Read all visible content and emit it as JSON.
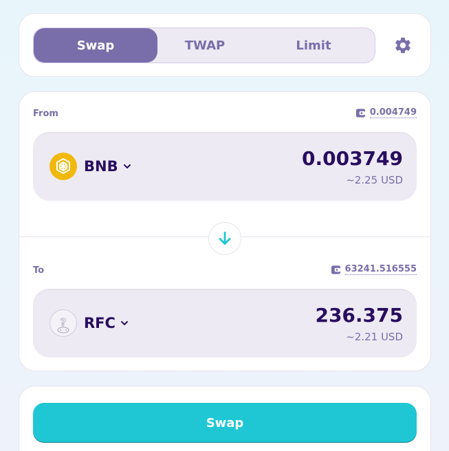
{
  "tabs": [
    {
      "label": "Swap",
      "active": true
    },
    {
      "label": "TWAP",
      "active": false
    },
    {
      "label": "Limit",
      "active": false
    }
  ],
  "icons": {
    "settings": "gear-icon",
    "wallet": "wallet-icon",
    "switch": "arrow-down-icon",
    "chevron": "chevron-down-icon"
  },
  "from": {
    "label": "From",
    "balance": "0.004749",
    "token": "BNB",
    "token_icon": "bnb-logo",
    "amount": "0.003749",
    "usd": "~2.25 USD"
  },
  "to": {
    "label": "To",
    "balance": "63241.516555",
    "token": "RFC",
    "token_icon": "unknown-token-icon",
    "amount": "236.375",
    "usd": "~2.21 USD"
  },
  "action": {
    "button_label": "Swap"
  },
  "colors": {
    "primary": "#7a6eaa",
    "accent": "#1fc7d4",
    "text": "#280d5f",
    "input_bg": "#eeeaf4",
    "bnb": "#f0b90b"
  }
}
